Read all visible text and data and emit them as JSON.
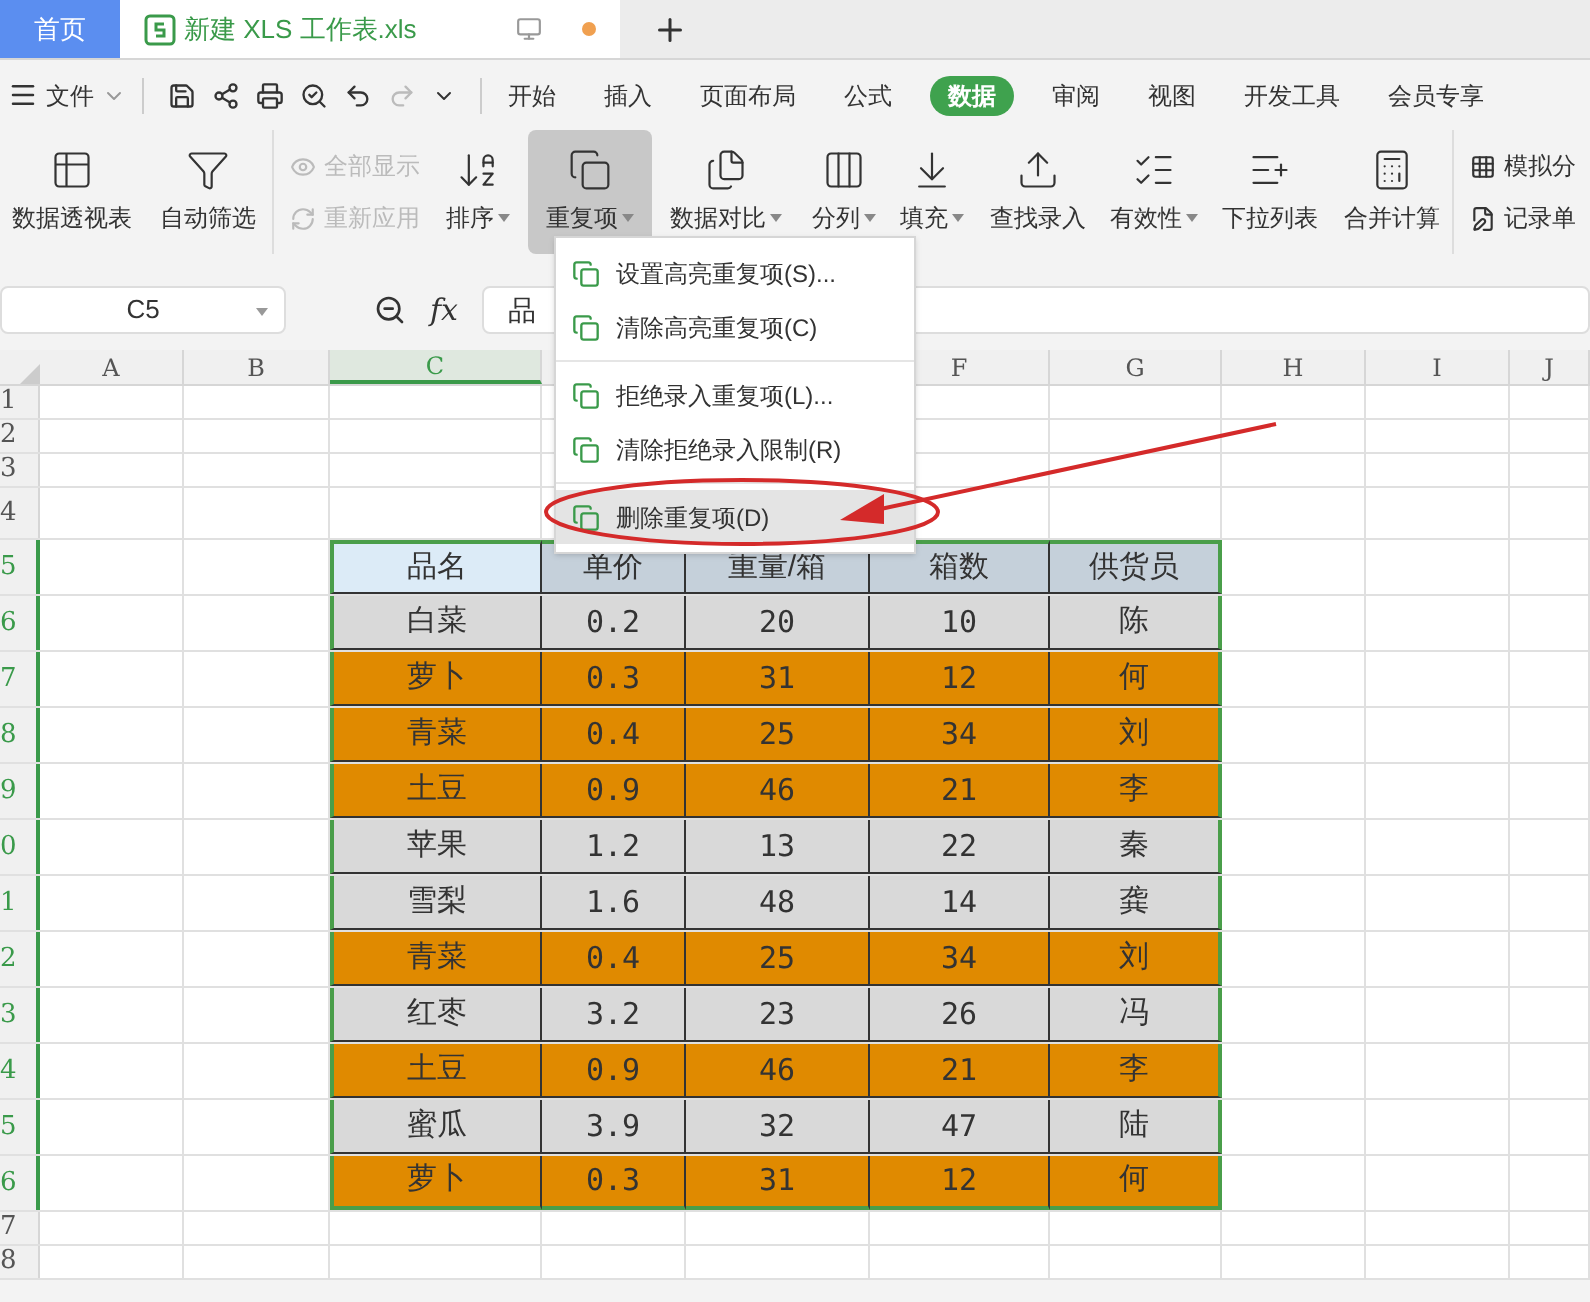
{
  "window_tabs": [
    {
      "label": "首页",
      "selected": false
    },
    {
      "label": "新建 XLS 工作表.xls",
      "selected": true
    }
  ],
  "menu": {
    "file": "文件",
    "tabs": [
      {
        "label": "开始",
        "selected": false
      },
      {
        "label": "插入",
        "selected": false
      },
      {
        "label": "页面布局",
        "selected": false
      },
      {
        "label": "公式",
        "selected": false
      },
      {
        "label": "数据",
        "selected": true
      },
      {
        "label": "审阅",
        "selected": false
      },
      {
        "label": "视图",
        "selected": false
      },
      {
        "label": "开发工具",
        "selected": false
      },
      {
        "label": "会员专享",
        "selected": false
      }
    ]
  },
  "ribbon": [
    {
      "kind": "large",
      "label": "数据透视表",
      "dropdown": false,
      "selected": false
    },
    {
      "kind": "large",
      "label": "自动筛选",
      "dropdown": false,
      "selected": false
    },
    {
      "kind": "pair",
      "items": [
        {
          "label": "全部显示",
          "disabled": true
        },
        {
          "label": "重新应用",
          "disabled": true
        }
      ]
    },
    {
      "kind": "large",
      "label": "排序",
      "dropdown": true,
      "selected": false
    },
    {
      "kind": "large",
      "label": "重复项",
      "dropdown": true,
      "selected": true
    },
    {
      "kind": "large",
      "label": "数据对比",
      "dropdown": true,
      "selected": false
    },
    {
      "kind": "large",
      "label": "分列",
      "dropdown": true,
      "selected": false
    },
    {
      "kind": "large",
      "label": "填充",
      "dropdown": true,
      "selected": false
    },
    {
      "kind": "large",
      "label": "查找录入",
      "dropdown": false,
      "selected": false
    },
    {
      "kind": "large",
      "label": "有效性",
      "dropdown": true,
      "selected": false
    },
    {
      "kind": "large",
      "label": "下拉列表",
      "dropdown": false,
      "selected": false
    },
    {
      "kind": "large",
      "label": "合并计算",
      "dropdown": false,
      "selected": false
    },
    {
      "kind": "pair",
      "items": [
        {
          "label": "模拟分",
          "disabled": false
        },
        {
          "label": "记录单",
          "disabled": false
        }
      ]
    }
  ],
  "formula_bar": {
    "cell": "C5",
    "function_label": "fx",
    "value": "品"
  },
  "column_headers": [
    {
      "label": "A",
      "selected": false
    },
    {
      "label": "B",
      "selected": false
    },
    {
      "label": "C",
      "selected": true
    },
    {
      "label": "F",
      "selected": false
    },
    {
      "label": "G",
      "selected": false
    },
    {
      "label": "H",
      "selected": false
    },
    {
      "label": "I",
      "selected": false
    },
    {
      "label": "J",
      "selected": false
    }
  ],
  "row_numbers": [
    {
      "label": "1",
      "selected": false
    },
    {
      "label": "2",
      "selected": false
    },
    {
      "label": "3",
      "selected": false
    },
    {
      "label": "4",
      "selected": false
    },
    {
      "label": "5",
      "selected": true
    },
    {
      "label": "6",
      "selected": true
    },
    {
      "label": "7",
      "selected": true
    },
    {
      "label": "8",
      "selected": true
    },
    {
      "label": "9",
      "selected": true
    },
    {
      "label": "0",
      "selected": true
    },
    {
      "label": "1",
      "selected": true
    },
    {
      "label": "2",
      "selected": true
    },
    {
      "label": "3",
      "selected": true
    },
    {
      "label": "4",
      "selected": true
    },
    {
      "label": "5",
      "selected": true
    },
    {
      "label": "6",
      "selected": true
    },
    {
      "label": "7",
      "selected": false
    },
    {
      "label": "8",
      "selected": false
    }
  ],
  "table": {
    "columns": [
      {
        "label": "品名",
        "selected": true
      },
      {
        "label": "单价",
        "selected": false
      },
      {
        "label": "重量/箱",
        "selected": false
      },
      {
        "label": "箱数",
        "selected": false
      },
      {
        "label": "供货员",
        "selected": false
      }
    ],
    "rows": [
      {
        "highlighted": false,
        "cells": [
          "白菜",
          "0.2",
          "20",
          "10",
          "陈"
        ]
      },
      {
        "highlighted": true,
        "cells": [
          "萝卜",
          "0.3",
          "31",
          "12",
          "何"
        ]
      },
      {
        "highlighted": true,
        "cells": [
          "青菜",
          "0.4",
          "25",
          "34",
          "刘"
        ]
      },
      {
        "highlighted": true,
        "cells": [
          "土豆",
          "0.9",
          "46",
          "21",
          "李"
        ]
      },
      {
        "highlighted": false,
        "cells": [
          "苹果",
          "1.2",
          "13",
          "22",
          "秦"
        ]
      },
      {
        "highlighted": false,
        "cells": [
          "雪梨",
          "1.6",
          "48",
          "14",
          "龚"
        ]
      },
      {
        "highlighted": true,
        "cells": [
          "青菜",
          "0.4",
          "25",
          "34",
          "刘"
        ]
      },
      {
        "highlighted": false,
        "cells": [
          "红枣",
          "3.2",
          "23",
          "26",
          "冯"
        ]
      },
      {
        "highlighted": true,
        "cells": [
          "土豆",
          "0.9",
          "46",
          "21",
          "李"
        ]
      },
      {
        "highlighted": false,
        "cells": [
          "蜜瓜",
          "3.9",
          "32",
          "47",
          "陆"
        ]
      },
      {
        "highlighted": true,
        "cells": [
          "萝卜",
          "0.3",
          "31",
          "12",
          "何"
        ]
      }
    ]
  },
  "dropdown_menu": [
    {
      "label": "设置高亮重复项(S)...",
      "selected": false,
      "divider_after": false
    },
    {
      "label": "清除高亮重复项(C)",
      "selected": false,
      "divider_after": true
    },
    {
      "label": "拒绝录入重复项(L)...",
      "selected": false,
      "divider_after": false
    },
    {
      "label": "清除拒绝录入限制(R)",
      "selected": false,
      "divider_after": true
    },
    {
      "label": "删除重复项(D)",
      "selected": true,
      "divider_after": false
    }
  ]
}
